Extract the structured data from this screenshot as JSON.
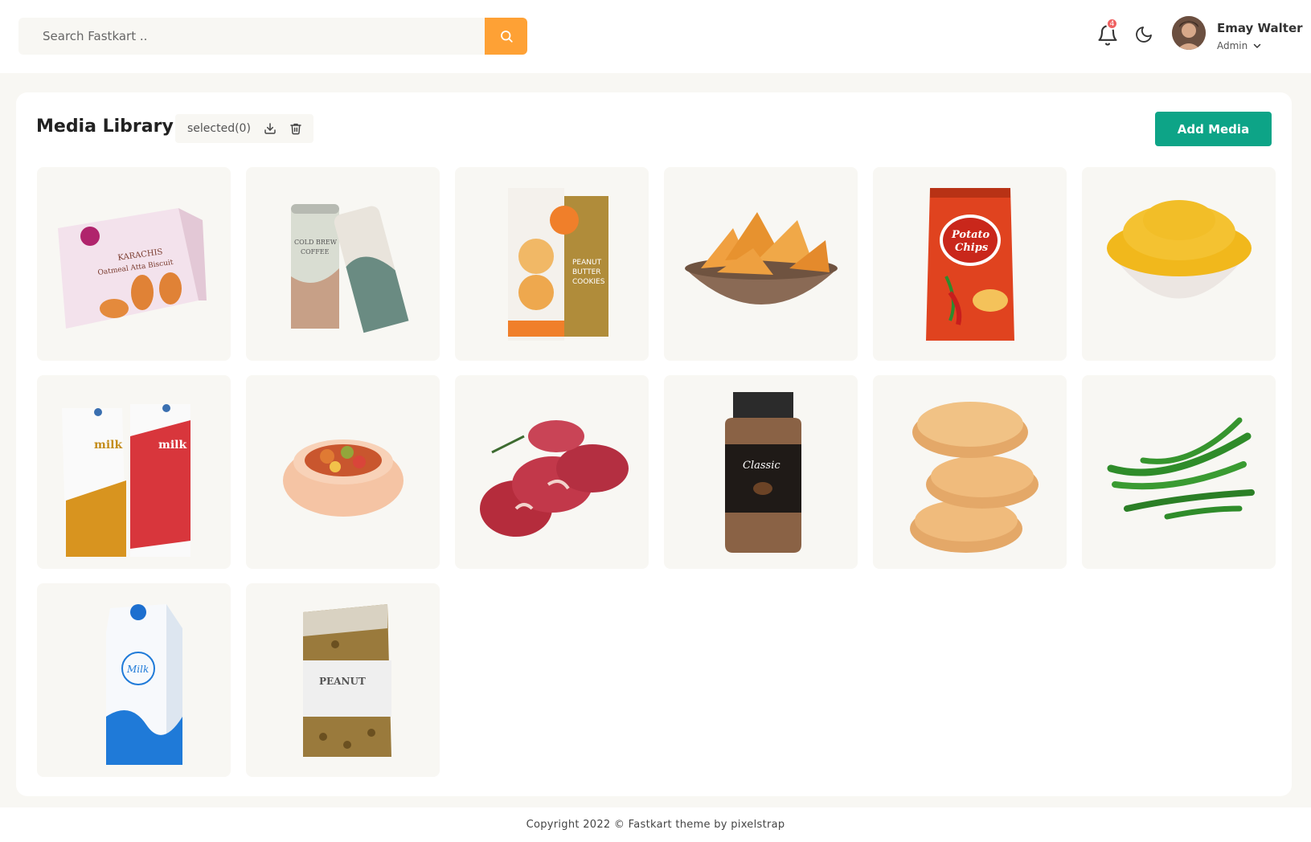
{
  "search": {
    "placeholder": "Search Fastkart .."
  },
  "header": {
    "notification_count": "4",
    "user_name": "Emay Walter",
    "user_role": "Admin"
  },
  "library": {
    "title": "Media Library",
    "selected_label": "selected(0)",
    "add_button": "Add Media",
    "items": [
      {
        "name": "Karachis Oatmeal Atta Biscuit box",
        "icon": "biscuit-box"
      },
      {
        "name": "Cold brew coffee cans",
        "icon": "coffee-cans"
      },
      {
        "name": "Peanut butter cookies box",
        "icon": "cookies-box"
      },
      {
        "name": "Nachos chips bowl",
        "icon": "nachos-bowl"
      },
      {
        "name": "Potato chips packet",
        "icon": "chips-packet"
      },
      {
        "name": "Yellow lentils bowl",
        "icon": "lentil-bowl"
      },
      {
        "name": "Milk cartons",
        "icon": "milk-cartons"
      },
      {
        "name": "Pet food bowl",
        "icon": "pet-food-bowl"
      },
      {
        "name": "Raw meat",
        "icon": "raw-meat"
      },
      {
        "name": "Classic coffee jar",
        "icon": "coffee-jar"
      },
      {
        "name": "Burger buns",
        "icon": "buns"
      },
      {
        "name": "Green chillies",
        "icon": "green-chillies"
      },
      {
        "name": "Milk carton",
        "icon": "milk-carton"
      },
      {
        "name": "Peanut bag",
        "icon": "peanut-bag"
      }
    ],
    "text_on_items": {
      "biscuit_brand": "KARACHIS",
      "biscuit_desc": "Oatmeal Atta Biscuit",
      "coffee_label": "COLD BREW",
      "coffee_label2": "COFFEE",
      "cookies_label": "PEANUT",
      "cookies_label2": "BUTTER",
      "cookies_label3": "COOKIES",
      "chips_label": "Potato",
      "chips_label2": "Chips",
      "milk_label": "milk",
      "jar_label": "Classic",
      "carton_label": "Milk",
      "peanut_label": "PEANUT"
    }
  },
  "footer": {
    "text": "Copyright 2022 © Fastkart theme by pixelstrap"
  },
  "colors": {
    "accent": "#0da487",
    "search_button": "#fea135",
    "badge": "#ef6262"
  }
}
